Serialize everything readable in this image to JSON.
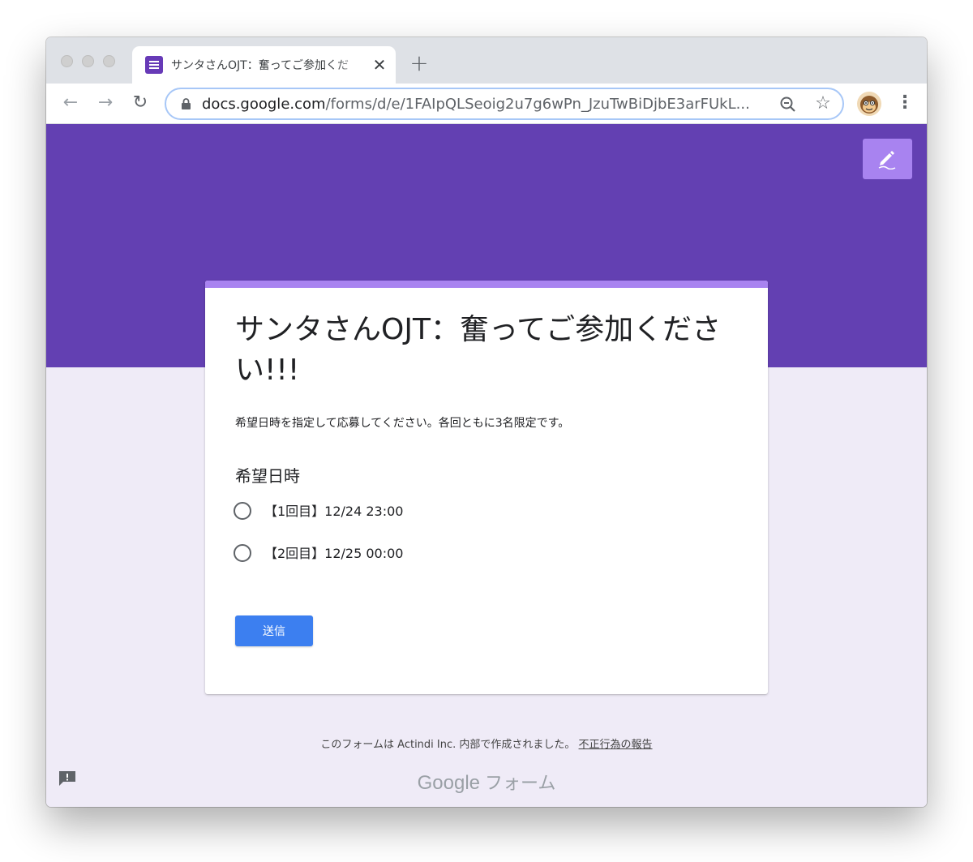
{
  "browser": {
    "tab": {
      "title": "サンタさんOJT：奮ってご参加くだ",
      "close_glyph": "✕"
    },
    "new_tab_glyph": "+",
    "nav": {
      "back_glyph": "←",
      "forward_glyph": "→",
      "reload_glyph": "↻"
    },
    "omnibox": {
      "domain": "docs.google.com",
      "path": "/forms/d/e/1FAIpQLSeoig2u7g6wPn_JzuTwBiDjbE3arFUkL..."
    },
    "star_glyph": "☆",
    "menu_glyph": "⋮"
  },
  "form": {
    "title": "サンタさんOJT：奮ってご参加ください!!!",
    "description": "希望日時を指定して応募してください。各回ともに3名限定です。",
    "question": {
      "title": "希望日時",
      "options": [
        "【1回目】12/24 23:00",
        "【2回目】12/25 00:00"
      ]
    },
    "submit_label": "送信"
  },
  "footer": {
    "text": "このフォームは Actindi Inc. 内部で作成されました。",
    "abuse_link": "不正行為の報告",
    "logo_google": "Google",
    "logo_forms": "フォーム"
  },
  "colors": {
    "banner": "#6340b2",
    "accent": "#a883f0",
    "page_bg": "#efebf7",
    "submit": "#3c7ff0"
  }
}
